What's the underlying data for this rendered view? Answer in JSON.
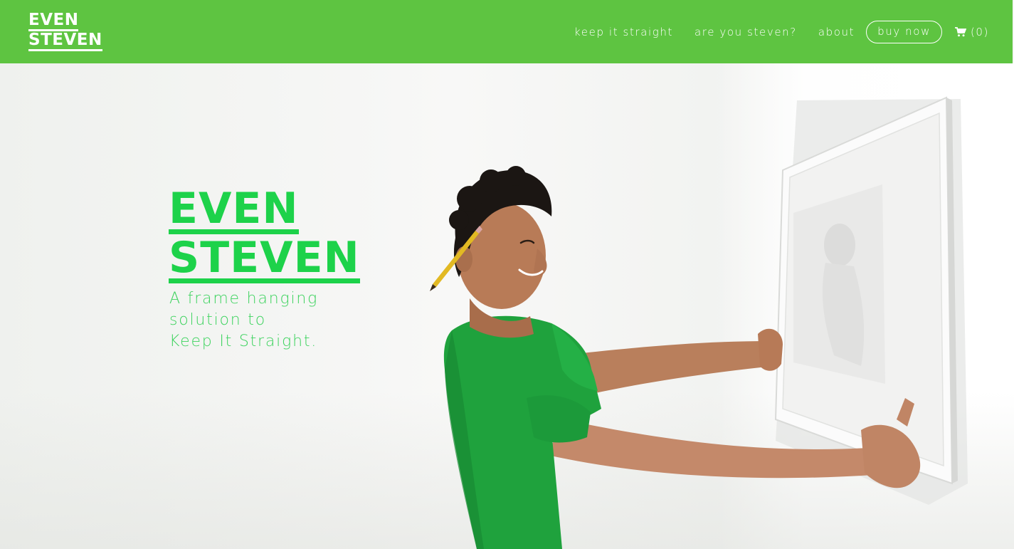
{
  "header": {
    "logo_line1": "EVEN",
    "logo_line2": "STEVEN",
    "nav": {
      "keep_it_straight": "keep it straight",
      "are_you_steven": "are you steven?",
      "about": "about",
      "buy_now": "buy now",
      "cart_count": "(0)"
    }
  },
  "hero": {
    "title_line1": "EVEN",
    "title_line2": "STEVEN",
    "tagline_line1": "A frame hanging",
    "tagline_line2": "solution to",
    "tagline_line3": "Keep It Straight."
  },
  "icons": {
    "cart": "shopping-cart-icon"
  },
  "colors": {
    "header_bg": "#5ec441",
    "brand_green": "#1dd24a",
    "shirt_green": "#1fa23d"
  }
}
